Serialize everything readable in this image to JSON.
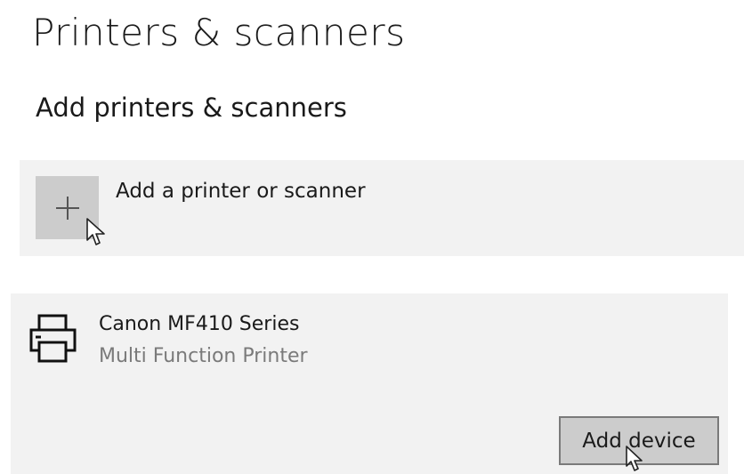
{
  "page": {
    "title": "Printers & scanners"
  },
  "add_section": {
    "title": "Add printers & scanners",
    "add_button_label": "Add a printer or scanner",
    "add_icon": "plus-icon"
  },
  "device": {
    "icon": "printer-icon",
    "name": "Canon MF410 Series",
    "type": "Multi Function Printer",
    "action_label": "Add device"
  },
  "colors": {
    "panel_background": "#f2f2f2",
    "tile_background": "#cccccc",
    "secondary_text": "#7a7a7a",
    "button_border": "#7a7a7a"
  }
}
